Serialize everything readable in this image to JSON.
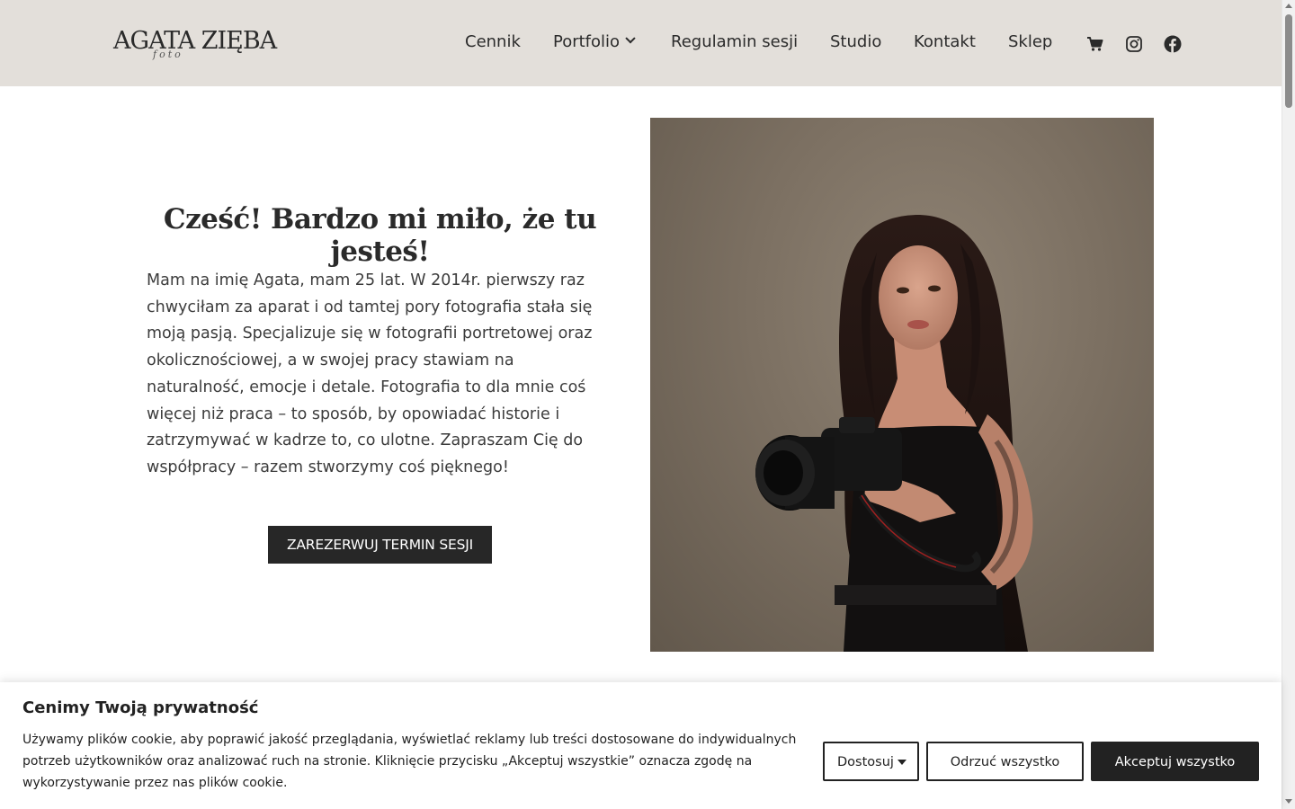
{
  "brand": {
    "logo_text": "AGATA ZIĘBA",
    "logo_script": "foto"
  },
  "nav": {
    "items": [
      {
        "label": "Cennik"
      },
      {
        "label": "Portfolio"
      },
      {
        "label": "Regulamin sesji"
      },
      {
        "label": "Studio"
      },
      {
        "label": "Kontakt"
      },
      {
        "label": "Sklep"
      }
    ],
    "icons": [
      "cart-icon",
      "instagram-icon",
      "facebook-icon"
    ]
  },
  "hero": {
    "title": "Cześć! Bardzo mi miło, że tu jesteś!",
    "text": "Mam na imię Agata, mam 25 lat. W 2014r. pierwszy raz chwyciłam za aparat i od tamtej pory fotografia stała się moją pasją. Specjalizuje się w fotografii portretowej oraz okolicznościowej, a w swojej pracy stawiam na naturalność, emocje i detale. Fotografia to dla mnie coś więcej niż praca – to sposób, by opowiadać historie i zatrzymywać w kadrze to, co ulotne. Zapraszam Cię do współpracy – razem stworzymy coś pięknego!",
    "cta": "ZAREZERWUJ TERMIN SESJI"
  },
  "cookie": {
    "title": "Cenimy Twoją prywatność",
    "text": "Używamy plików cookie, aby poprawić jakość przeglądania, wyświetlać reklamy lub treści dostosowane do indywidualnych potrzeb użytkowników oraz analizować ruch na stronie. Kliknięcie przycisku „Akceptuj wszystkie” oznacza zgodę na wykorzystywanie przez nas plików cookie.",
    "customize": "Dostosuj",
    "reject": "Odrzuć wszystko",
    "accept": "Akceptuj wszystko"
  },
  "colors": {
    "header_bg": "#e3dfda",
    "button_dark": "#272727",
    "text": "#3c3c3c"
  }
}
